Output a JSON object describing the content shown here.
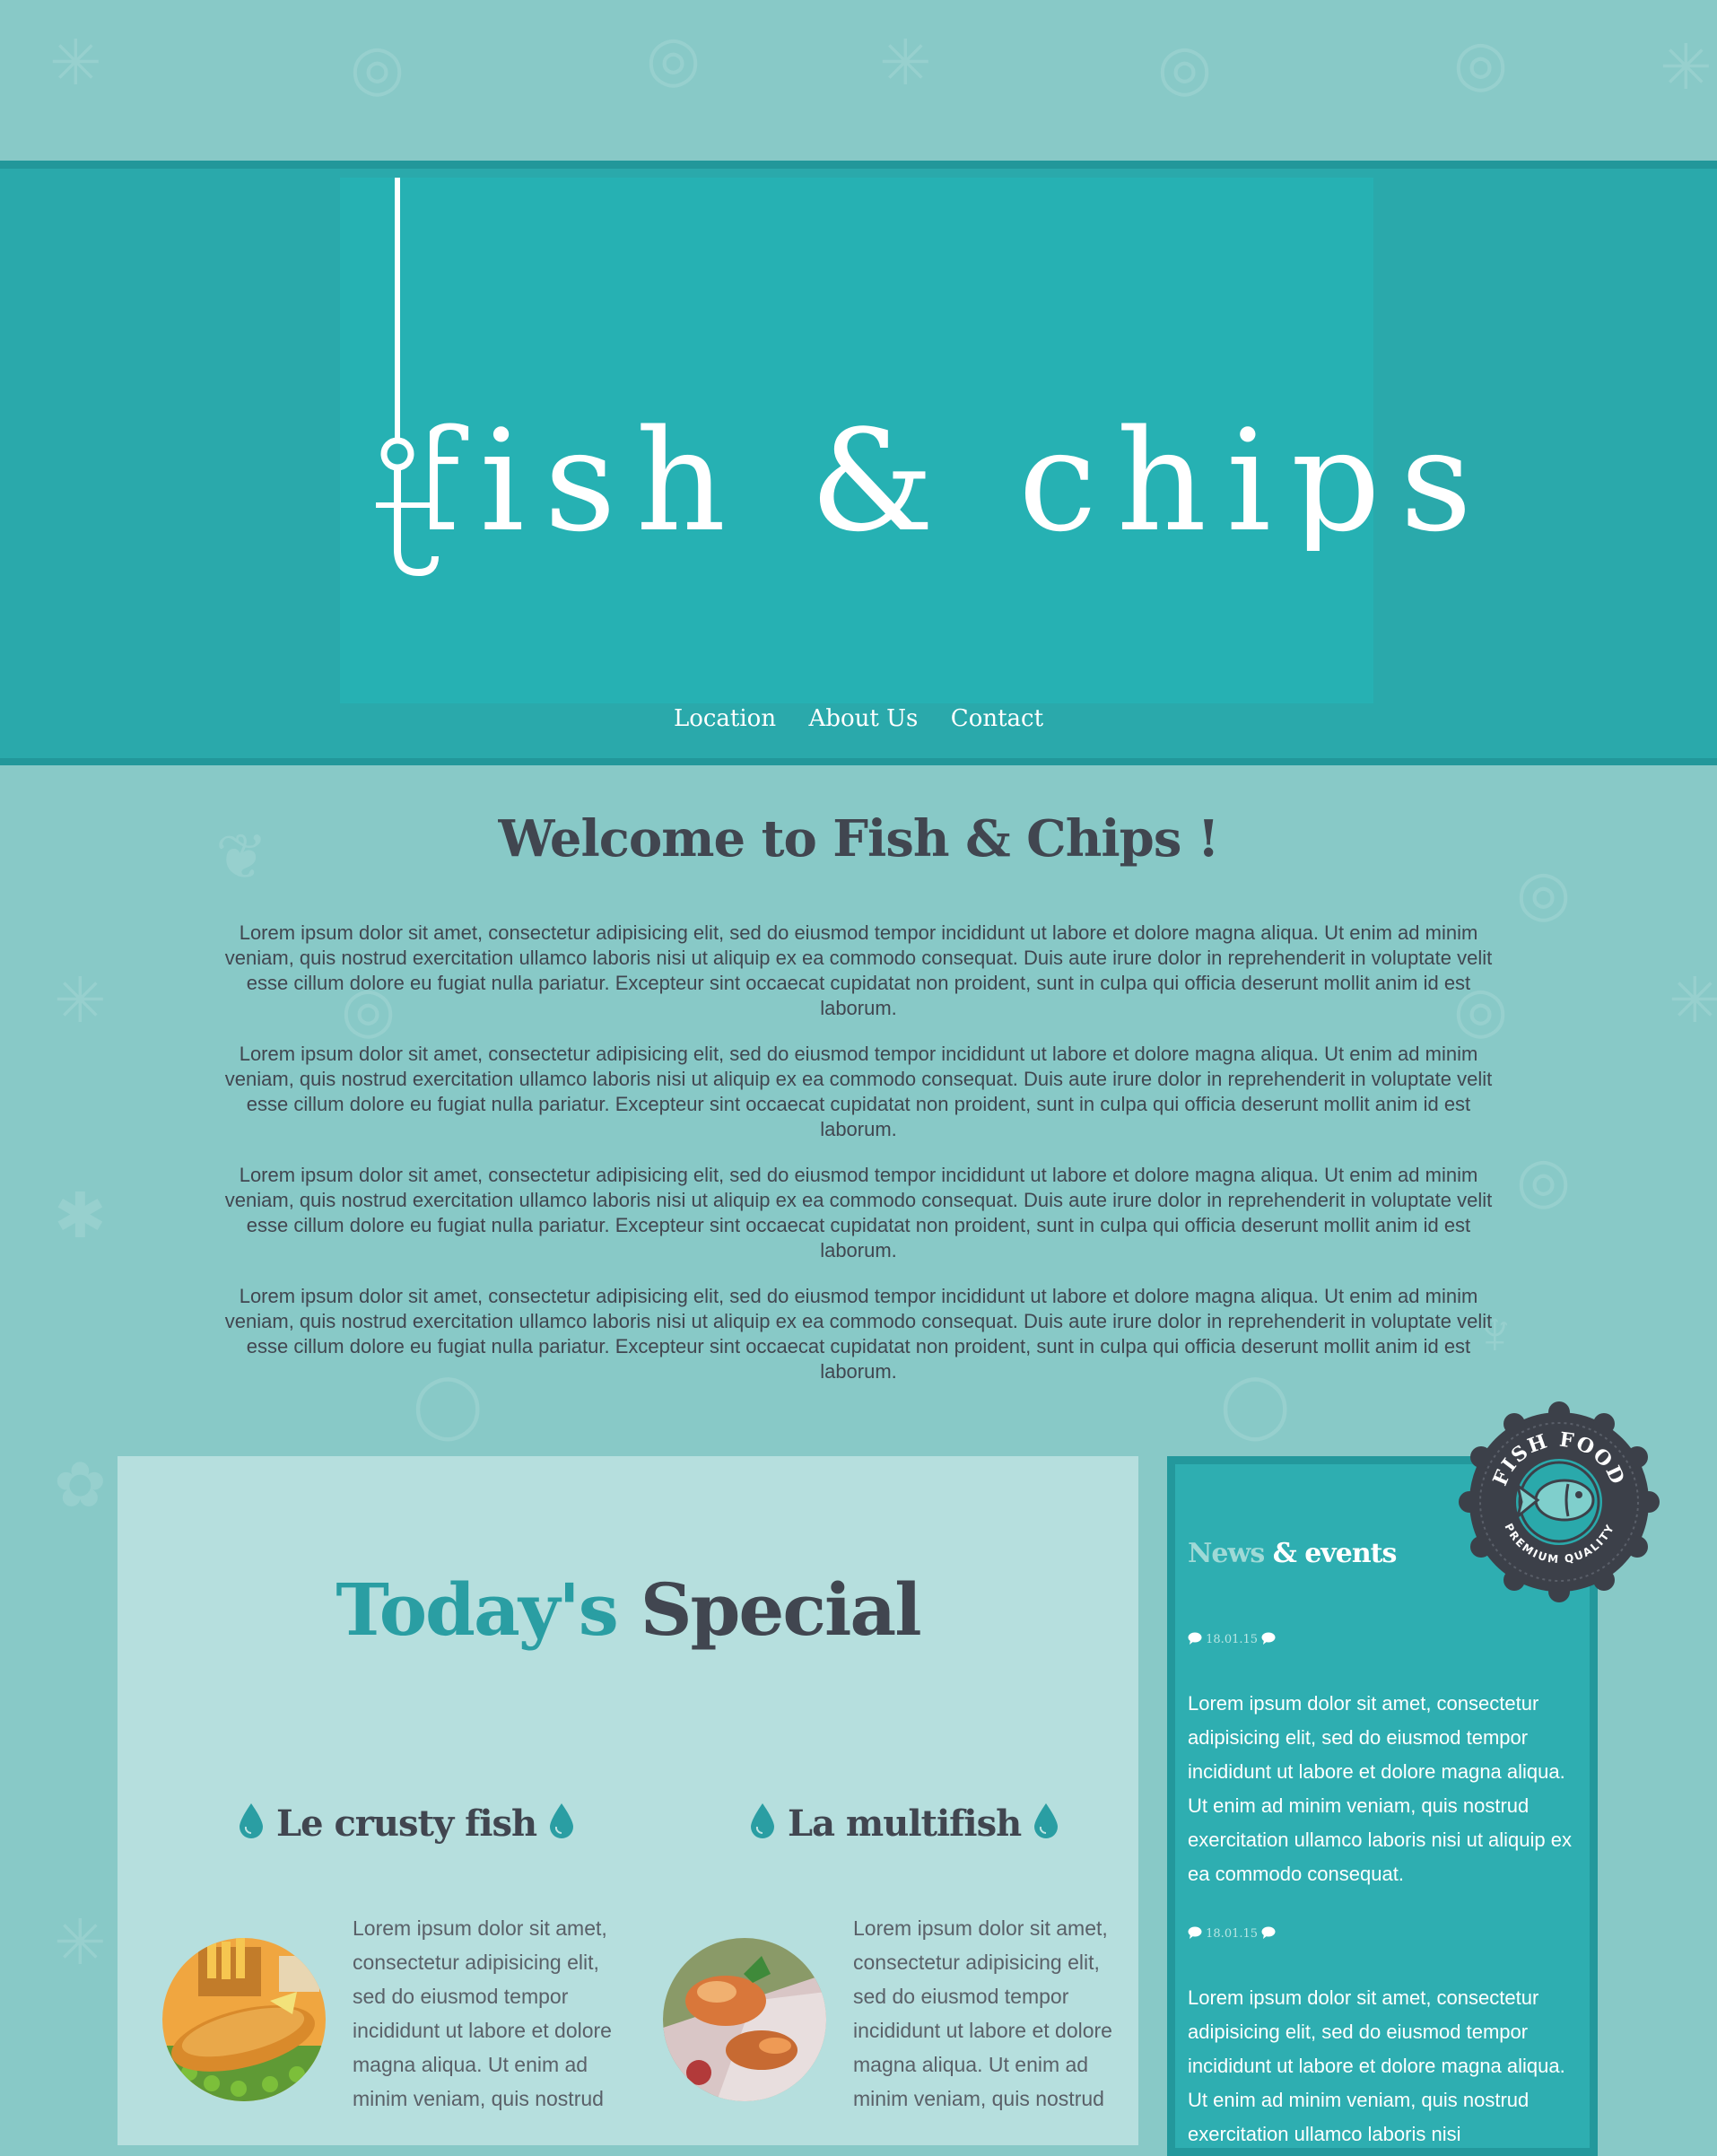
{
  "header": {
    "logo_text": "fish & chips",
    "nav": [
      "Location",
      "About Us",
      "Contact"
    ]
  },
  "welcome": {
    "title": "Welcome to Fish & Chips !",
    "paragraphs": [
      "Lorem ipsum dolor sit amet, consectetur adipisicing elit, sed do eiusmod tempor incididunt ut labore et dolore magna aliqua. Ut enim ad minim veniam, quis nostrud exercitation ullamco laboris nisi ut aliquip ex ea commodo consequat. Duis aute irure dolor in reprehenderit in voluptate velit esse cillum dolore eu fugiat nulla pariatur. Excepteur sint occaecat cupidatat non proident, sunt in culpa qui officia deserunt mollit anim id est laborum.",
      "Lorem ipsum dolor sit amet, consectetur adipisicing elit, sed do eiusmod tempor incididunt ut labore et dolore magna aliqua. Ut enim ad minim veniam, quis nostrud exercitation ullamco laboris nisi ut aliquip ex ea commodo consequat. Duis aute irure dolor in reprehenderit in voluptate velit esse cillum dolore eu fugiat nulla pariatur. Excepteur sint occaecat cupidatat non proident, sunt in culpa qui officia deserunt mollit anim id est laborum.",
      "Lorem ipsum dolor sit amet, consectetur adipisicing elit, sed do eiusmod tempor incididunt ut labore et dolore magna aliqua. Ut enim ad minim veniam, quis nostrud exercitation ullamco laboris nisi ut aliquip ex ea commodo consequat. Duis aute irure dolor in reprehenderit in voluptate velit esse cillum dolore eu fugiat nulla pariatur. Excepteur sint occaecat cupidatat non proident, sunt in culpa qui officia deserunt mollit anim id est laborum.",
      "Lorem ipsum dolor sit amet, consectetur adipisicing elit, sed do eiusmod tempor incididunt ut labore et dolore magna aliqua. Ut enim ad minim veniam, quis nostrud exercitation ullamco laboris nisi ut aliquip ex ea commodo consequat. Duis aute irure dolor in reprehenderit in voluptate velit esse cillum dolore eu fugiat nulla pariatur. Excepteur sint occaecat cupidatat non proident, sunt in culpa qui officia deserunt mollit anim id est laborum."
    ]
  },
  "special": {
    "title_accent": "Today's",
    "title_rest": "Special",
    "items": [
      {
        "name": "Le crusty fish",
        "text": "Lorem ipsum dolor sit amet, consectetur adipisicing elit, sed do eiusmod tempor incididunt ut labore et dolore magna aliqua. Ut enim ad minim veniam, quis nostrud"
      },
      {
        "name": "La multifish",
        "text": "Lorem ipsum dolor sit amet, consectetur adipisicing elit, sed do eiusmod tempor incididunt ut labore et dolore magna aliqua. Ut enim ad minim veniam, quis nostrud"
      }
    ]
  },
  "news": {
    "title_light": "News",
    "title_bold": "& events",
    "entries": [
      {
        "date": "18.01.15",
        "text": "Lorem ipsum dolor sit amet, consectetur adipisicing elit, sed do eiusmod tempor incididunt ut labore et dolore magna aliqua. Ut enim ad minim veniam, quis nostrud exercitation ullamco laboris nisi ut aliquip ex ea commodo consequat."
      },
      {
        "date": "18.01.15",
        "text": "Lorem ipsum dolor sit amet, consectetur adipisicing elit, sed do eiusmod tempor incididunt ut labore et dolore magna aliqua. Ut enim ad minim veniam, quis nostrud exercitation ullamco laboris nisi"
      }
    ]
  },
  "badge": {
    "top_text": "FISH FOOD",
    "bottom_text": "PREMIUM QUALITY"
  },
  "colors": {
    "page_bg": "#88c9c7",
    "header_bg": "#2aa9ab",
    "accent": "#2a9ea3",
    "text_dark": "#414650",
    "panel_light": "#b6dfde",
    "news_bg": "#2eaeb1"
  },
  "icons": [
    "hook-icon",
    "drop-icon",
    "comment-icon",
    "fish-icon"
  ]
}
